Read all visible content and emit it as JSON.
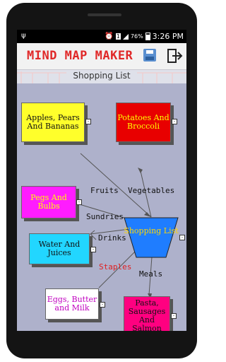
{
  "status_bar": {
    "sim_label": "1",
    "battery": "76%",
    "time": "3:26 PM"
  },
  "app": {
    "title": "MIND MAP MAKER",
    "subtitle": "Shopping List"
  },
  "central_node": {
    "label": "Shopping List",
    "color": "#1f7dff",
    "text_color": "#ffd600"
  },
  "nodes": [
    {
      "id": "apples",
      "label": "Apples, Pears And Bananas",
      "bg": "#ffff2b",
      "color": "#111111"
    },
    {
      "id": "potatoes",
      "label": "Potatoes And Broccoli",
      "bg": "#e80000",
      "color": "#ffff00"
    },
    {
      "id": "pegs",
      "label": "Pegs And Bulbs",
      "bg": "#ff1cff",
      "color": "#ffff00"
    },
    {
      "id": "water",
      "label": "Water And Juices",
      "bg": "#22d6ff",
      "color": "#111111"
    },
    {
      "id": "eggs",
      "label": "Eggs, Butter and Milk",
      "bg": "#ffffff",
      "color": "#c000c0"
    },
    {
      "id": "pasta",
      "label": "Pasta, Sausages And Salmon",
      "bg": "#ff0080",
      "color": "#111111"
    }
  ],
  "edge_labels": [
    {
      "id": "fruits",
      "text": "Fruits",
      "color": "#111111"
    },
    {
      "id": "vegetables",
      "text": "Vegetables",
      "color": "#111111"
    },
    {
      "id": "sundries",
      "text": "Sundries",
      "color": "#111111"
    },
    {
      "id": "drinks",
      "text": "Drinks",
      "color": "#111111"
    },
    {
      "id": "staples",
      "text": "Staples",
      "color": "#e02020"
    },
    {
      "id": "meals",
      "text": "Meals",
      "color": "#111111"
    }
  ],
  "handle_symbol": "-",
  "icons": [
    "usb-icon",
    "alarm-icon",
    "signal-icon",
    "battery-icon",
    "save-icon",
    "exit-icon"
  ]
}
